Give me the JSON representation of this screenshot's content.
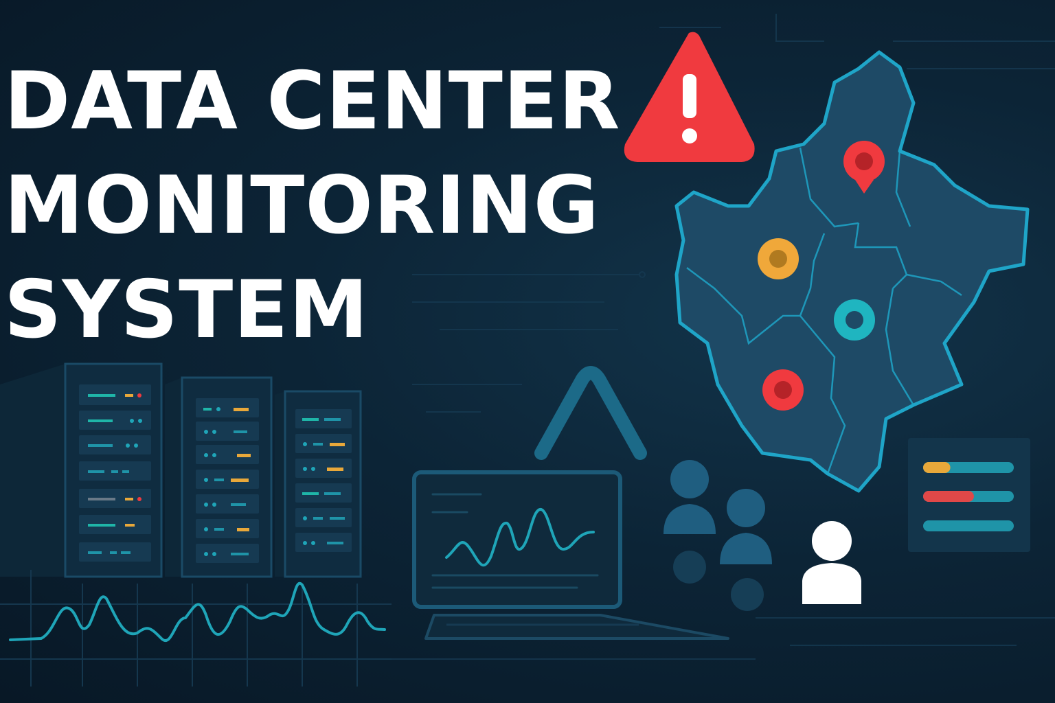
{
  "title": {
    "line1": "DATA CENTER",
    "line2": "MONITORING",
    "line3": "SYSTEM"
  },
  "colors": {
    "background": "#0b1e2e",
    "alert_red": "#f03a3f",
    "warning_orange": "#f0a83a",
    "ok_teal": "#1fa5b8",
    "map_fill": "#1e4a66",
    "map_outline": "#1fa5c8"
  },
  "icons": [
    "warning-icon",
    "server-rack-icon",
    "laptop-icon",
    "users-icon",
    "user-icon",
    "map-pin-icon",
    "status-bars-icon"
  ],
  "map_markers": [
    {
      "status": "critical",
      "color": "#f03a3f"
    },
    {
      "status": "warning",
      "color": "#f0a83a"
    },
    {
      "status": "ok",
      "color": "#1fb5c0"
    },
    {
      "status": "critical",
      "color": "#f03a3f"
    }
  ],
  "status_bars": [
    {
      "color": "#e8a83a",
      "level": 0.3
    },
    {
      "color": "#e04848",
      "level": 0.56
    },
    {
      "color": "#1f94a8",
      "level": 0.0
    }
  ]
}
